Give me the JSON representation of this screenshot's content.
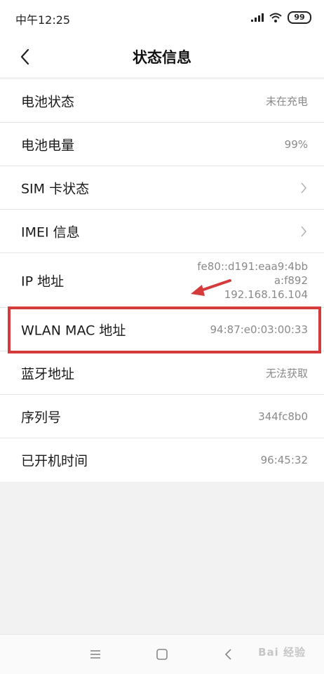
{
  "status_bar": {
    "time": "中午12:25",
    "battery": "99"
  },
  "header": {
    "title": "状态信息"
  },
  "rows": [
    {
      "label": "电池状态",
      "value": "未在充电"
    },
    {
      "label": "电池电量",
      "value": "99%"
    },
    {
      "label": "SIM 卡状态"
    },
    {
      "label": "IMEI 信息"
    },
    {
      "label": "IP 地址",
      "value_lines": [
        "fe80::d191:eaa9:4bb",
        "a:f892",
        "192.168.16.104"
      ]
    },
    {
      "label": "WLAN MAC 地址",
      "value": "94:87:e0:03:00:33"
    },
    {
      "label": "蓝牙地址",
      "value": "无法获取"
    },
    {
      "label": "序列号",
      "value": "344fc8b0"
    },
    {
      "label": "已开机时间",
      "value": "96:45:32"
    }
  ],
  "watermark": "Bai 经验",
  "colors": {
    "highlight": "#d63b3b",
    "value_text": "#8a8a8a"
  },
  "icons": [
    "signal-icon",
    "wifi-icon",
    "battery-icon",
    "back-arrow-icon",
    "chevron-right-icon",
    "menu-icon",
    "home-icon",
    "nav-back-icon",
    "red-arrow-annotation"
  ]
}
